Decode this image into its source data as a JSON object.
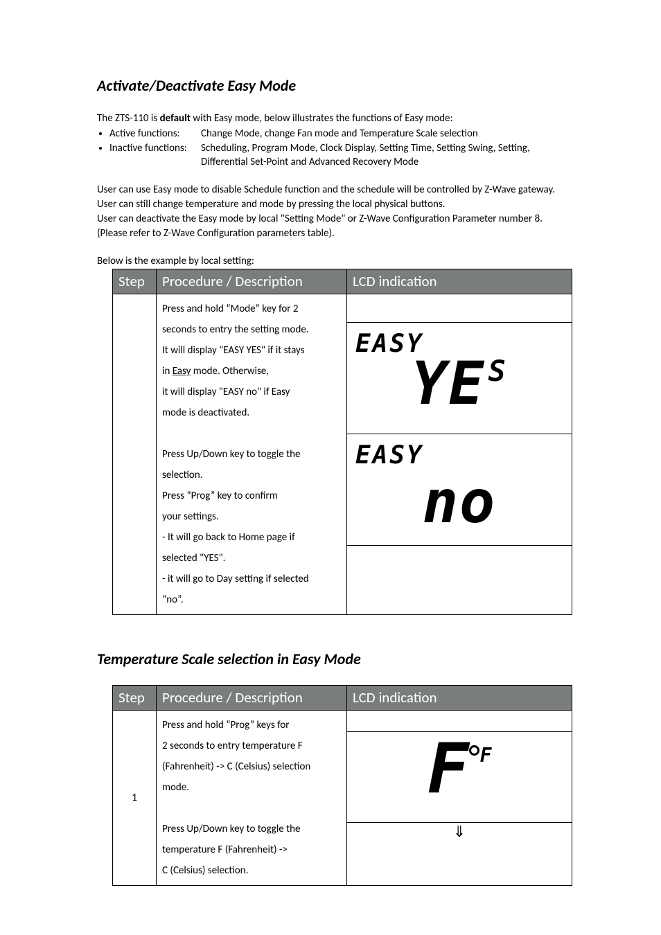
{
  "section1": {
    "title": "Activate/Deactivate Easy Mode",
    "intro_line": "The ZTS-110 is ",
    "intro_bold": "default",
    "intro_rest": " with Easy mode, below illustrates the functions of Easy mode:",
    "bullet1_label": "Active functions:",
    "bullet1_text": "Change Mode, change Fan mode and Temperature Scale selection",
    "bullet2_label": "Inactive functions:",
    "bullet2_text": "Scheduling, Program Mode, Clock Display, Setting Time, Setting Swing, Setting,",
    "bullet2_cont": "Differential Set-Point and Advanced Recovery Mode",
    "para1": "User can use Easy mode to disable Schedule function and the schedule will be controlled by Z-Wave gateway. User can still change temperature and mode by pressing the local physical buttons.",
    "para2": "User can deactivate the Easy mode by local \"Setting Mode\" or Z-Wave Configuration Parameter number 8. (Please refer to Z-Wave Configuration parameters table).",
    "caption": "Below is the example by local setting:",
    "table": {
      "h_step": "Step",
      "h_proc": "Procedure / Description",
      "h_lcd": "LCD indication",
      "row1": {
        "desc_l1": "Press and hold  “Mode” key for 2",
        "desc_l2": "seconds to entry the setting mode.",
        "desc_l3a": "It will display \"EASY YES\" if it stays",
        "desc_l3b_pre": "in ",
        "desc_l3b_u": "Easy",
        "desc_l3b_post": " mode. Otherwise,",
        "desc_l4": "it will display \"EASY no\" if Easy",
        "desc_l5": "mode is deactivated.",
        "desc_gap": " ",
        "desc_l6": "Press Up/Down key to toggle the",
        "desc_l7": "selection.",
        "desc_l8": "Press “Prog” key to confirm",
        "desc_l9": "your settings.",
        "desc_l10": "- It will go back to Home page if",
        "desc_l11": "selected \"YES\".",
        "desc_l12": "- it will go to Day setting if selected",
        "desc_l13": "“no”."
      },
      "lcd1_top": "EASY",
      "lcd1_main": "YE",
      "lcd1_sub": "S",
      "lcd2_top": "EASY",
      "lcd2_main": "no"
    }
  },
  "section2": {
    "title": "Temperature Scale selection in Easy Mode",
    "table": {
      "h_step": "Step",
      "h_proc": "Procedure / Description",
      "h_lcd": "LCD indication",
      "step": "1",
      "desc_l1": "Press and hold “Prog” keys for",
      "desc_l2": "2 seconds to entry temperature F",
      "desc_l3": "(Fahrenheit) -> C (Celsius) selection",
      "desc_l4": "mode.",
      "desc_gap": " ",
      "desc_l5": "Press Up/Down key to toggle the",
      "desc_l6": "temperature F (Fahrenheit) ->",
      "desc_l7": "C (Celsius) selection.",
      "lcd_big": "F",
      "lcd_unit": "F",
      "arrow": "⇓"
    }
  }
}
